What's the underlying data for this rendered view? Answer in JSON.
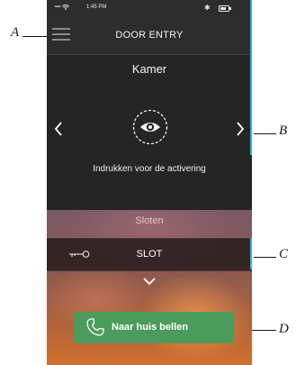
{
  "status_bar": {
    "signal": "••• ",
    "time": "1:45 PM",
    "bluetooth": "✱",
    "battery_level": 0.8
  },
  "header": {
    "title": "DOOR ENTRY"
  },
  "camera": {
    "title": "Kamer",
    "activate_text": "Indrukken voor de activering"
  },
  "locks": {
    "section_title": "Sloten",
    "items": [
      {
        "label": "SLOT"
      }
    ]
  },
  "call_button": {
    "label": "Naar huis bellen"
  },
  "callouts": {
    "a": "A",
    "b": "B",
    "c": "C",
    "d": "D"
  },
  "colors": {
    "accent": "#2fb3c9",
    "call_green": "#4b9b5c",
    "header_bg": "#2d2d2d"
  },
  "icons": [
    "menu-icon",
    "wifi-icon",
    "bluetooth-icon",
    "battery-icon",
    "chevron-left-icon",
    "chevron-right-icon",
    "eye-icon",
    "key-icon",
    "chevron-down-icon",
    "phone-icon"
  ]
}
